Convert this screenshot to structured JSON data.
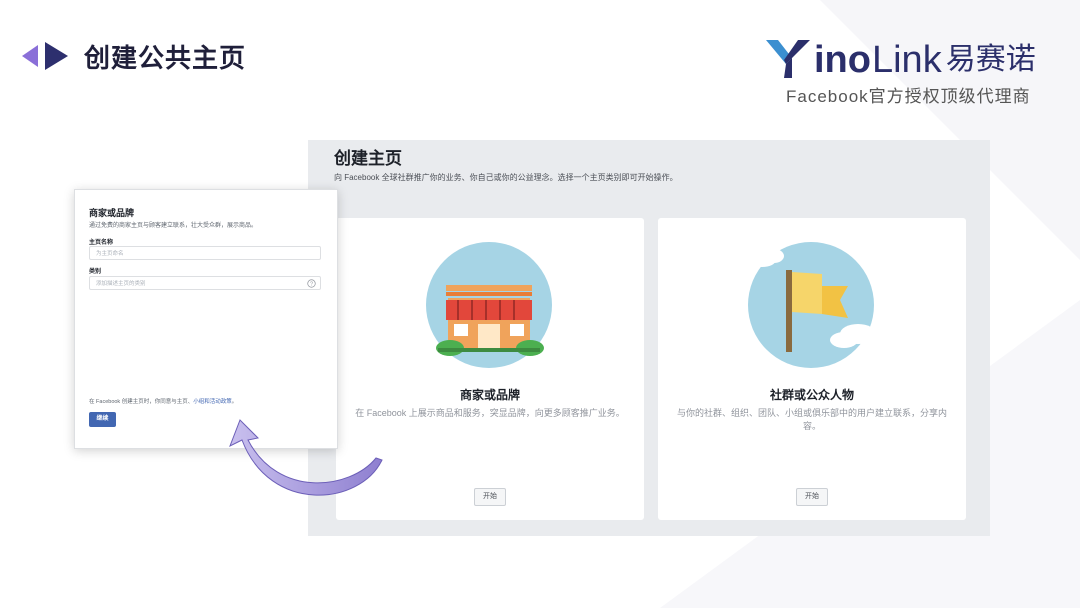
{
  "header": {
    "title": "创建公共主页",
    "nav_icon": "triangle-arrows-icon"
  },
  "logo": {
    "brand_bold": "ino",
    "brand_light": "Link",
    "brand_cn": "易赛诺",
    "tagline": "Facebook官方授权顶级代理商",
    "colors": {
      "navy": "#2b2f6b",
      "blue": "#3b8fd0"
    }
  },
  "fb": {
    "heading": "创建主页",
    "description": "向 Facebook 全球社群推广你的业务、你自己或你的公益理念。选择一个主页类别即可开始操作。",
    "cards": [
      {
        "title": "商家或品牌",
        "description": "在 Facebook 上展示商品和服务，突显品牌，向更多顾客推广业务。",
        "button": "开始",
        "icon": "storefront-icon"
      },
      {
        "title": "社群或公众人物",
        "description": "与你的社群、组织、团队、小组或俱乐部中的用户建立联系，分享内容。",
        "button": "开始",
        "icon": "flag-icon"
      }
    ]
  },
  "form": {
    "title": "商家或品牌",
    "subtitle": "通过免费的商家主页与顾客建立联系，壮大受众群，展示商品。",
    "name_label": "主页名称",
    "name_placeholder": "为主页命名",
    "category_label": "类别",
    "category_placeholder": "添加描述主页的类别",
    "footer_text": "在 Facebook 创建主页时，你同意与主页、",
    "footer_link": "小组和活动政策",
    "footer_end": "。",
    "submit_label": "继续"
  },
  "colors": {
    "accent": "#4267b2",
    "panel": "#e9ebee",
    "arrow": "#9b8ad6"
  }
}
